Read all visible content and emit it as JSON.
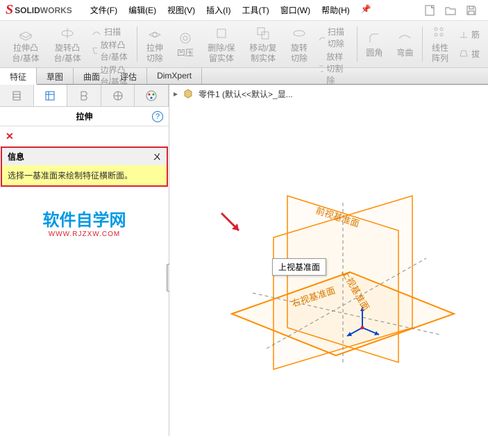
{
  "brand": {
    "s": "S",
    "solid": "SOLID",
    "works": "WORKS"
  },
  "menu": [
    {
      "label": "文件(F)"
    },
    {
      "label": "编辑(E)"
    },
    {
      "label": "视图(V)"
    },
    {
      "label": "插入(I)"
    },
    {
      "label": "工具(T)"
    },
    {
      "label": "窗口(W)"
    },
    {
      "label": "帮助(H)"
    }
  ],
  "ribbon": {
    "extrude": "拉伸凸台/基体",
    "revolve": "旋转凸台/基体",
    "sweep": "扫描",
    "loft": "放样凸台/基体",
    "boundary": "边界凸台/基体",
    "extrude_cut": "拉伸切除",
    "hole": "凹压",
    "delete_keep": "删除/保留实体",
    "move_copy": "移动/复制实体",
    "rotate_cut": "旋转切除",
    "sweep_cut": "扫描切除",
    "loft_cut": "放样切割除",
    "boundary_cut": "边界切除",
    "fillet": "圆角",
    "curve": "弯曲",
    "linear_pattern": "线性阵列",
    "shell": "筋",
    "draft": "拔"
  },
  "tabs": [
    "特征",
    "草图",
    "曲面",
    "评估",
    "DimXpert"
  ],
  "active_tab": 0,
  "panel": {
    "title": "拉伸",
    "info_header": "信息",
    "info_body": "选择一基准面来绘制特征横断面。"
  },
  "watermark": {
    "main": "软件自学网",
    "sub": "WWW.RJZXW.COM"
  },
  "breadcrumb": {
    "part": "零件1  (默认<<默认>_显..."
  },
  "planes": {
    "front": "前视基准面",
    "top": "上视基准面",
    "right": "右视基准面"
  },
  "tooltip": "上视基准面"
}
